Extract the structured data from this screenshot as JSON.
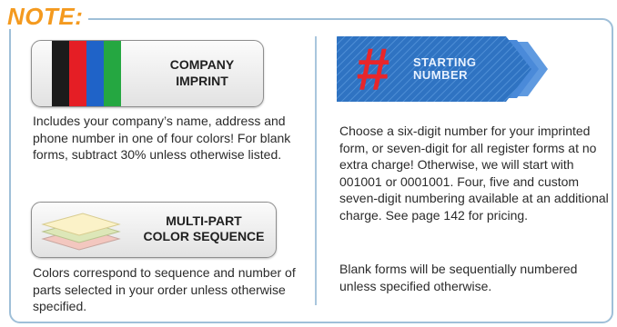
{
  "header": {
    "note_label": "NOTE:"
  },
  "colors": {
    "accent_orange": "#f49a1f",
    "frame_blue": "#9fbfd8",
    "banner_blue": "#2f73c2",
    "hash_red": "#e8262a",
    "stripes": [
      "#1b1b1b",
      "#e51e25",
      "#1f63c8",
      "#25a741"
    ]
  },
  "left": {
    "company_imprint": {
      "label_line1": "COMPANY",
      "label_line2": "IMPRINT",
      "icon": "color-stripes-icon",
      "description": "Includes your company’s name, address and phone number in one of four colors! For blank forms, subtract 30% unless otherwise listed."
    },
    "multi_part": {
      "label_line1": "MULTI-PART",
      "label_line2": "COLOR SEQUENCE",
      "icon": "stacked-sheets-icon",
      "description": "Colors correspond to sequence and number of parts selected in your order unless otherwise specified."
    }
  },
  "right": {
    "starting_number": {
      "hash_symbol": "#",
      "label_line1": "STARTING",
      "label_line2": "NUMBER",
      "icon": "hash-icon",
      "description": "Choose a six-digit number for your imprinted form, or seven-digit for all register forms at no extra charge! Otherwise, we will start with 001001 or 0001001. Four, five and custom seven-digit numbering available at an additional charge. See page 142 for pricing.",
      "note": "Blank forms will be sequentially numbered unless specified otherwise."
    }
  }
}
